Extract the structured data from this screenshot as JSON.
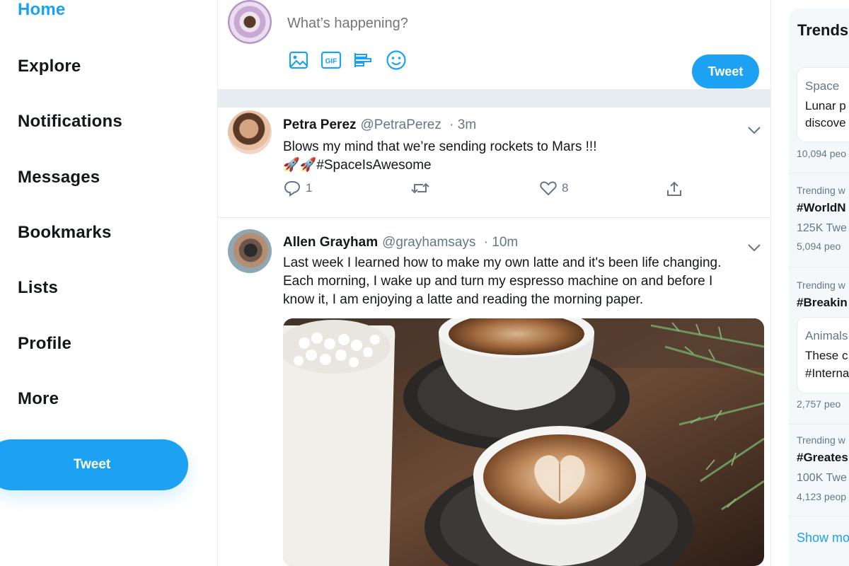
{
  "nav": {
    "items": [
      {
        "label": "Home",
        "active": true
      },
      {
        "label": "Explore"
      },
      {
        "label": "Notifications"
      },
      {
        "label": "Messages"
      },
      {
        "label": "Bookmarks"
      },
      {
        "label": "Lists"
      },
      {
        "label": "Profile"
      },
      {
        "label": "More"
      }
    ],
    "tweet_button": "Tweet"
  },
  "compose": {
    "placeholder": "What’s happening?",
    "tools": [
      "image-icon",
      "gif-icon",
      "poll-icon",
      "emoji-icon"
    ],
    "gif_label": "GIF",
    "tweet_button": "Tweet"
  },
  "tweets": [
    {
      "name": "Petra Perez",
      "handle": "@PetraPerez",
      "time": "· 3m",
      "text_line1": "Blows my mind that we’re sending rockets to Mars !!!",
      "text_line2": "🚀🚀#SpaceIsAwesome",
      "replies": "1",
      "retweets": "",
      "likes": "8"
    },
    {
      "name": "Allen Grayham",
      "handle": "@grayhamsays",
      "time": "· 10m",
      "text_line1": "Last week I learned how to make my own latte and it's been life changing.",
      "text_line2": "Each morning, I wake up and turn my espresso machine on and before I",
      "text_line3": "know it, I am enjoying a latte and reading the morning paper."
    }
  ],
  "trends": {
    "title": "Trends",
    "items": [
      {
        "category": "Space",
        "line1": "Lunar p",
        "line2": "discove",
        "count": "10,094 peo"
      },
      {
        "category": "Trending w",
        "tag": "#WorldN",
        "tweets": "125K Twe",
        "count": "5,094 peo"
      },
      {
        "category": "Trending w",
        "tag": "#Breakin"
      },
      {
        "category": "Animals",
        "line1": "These c",
        "line2": "#Interna",
        "count": "2,757 peo"
      },
      {
        "category": "Trending w",
        "tag": "#Greates",
        "tweets": "100K Twe",
        "count": "4,123 peop"
      }
    ],
    "show_more": "Show mo"
  },
  "colors": {
    "accent": "#1da1f2",
    "text": "#14171a",
    "muted": "#657786",
    "divider": "#e6ecf0"
  }
}
